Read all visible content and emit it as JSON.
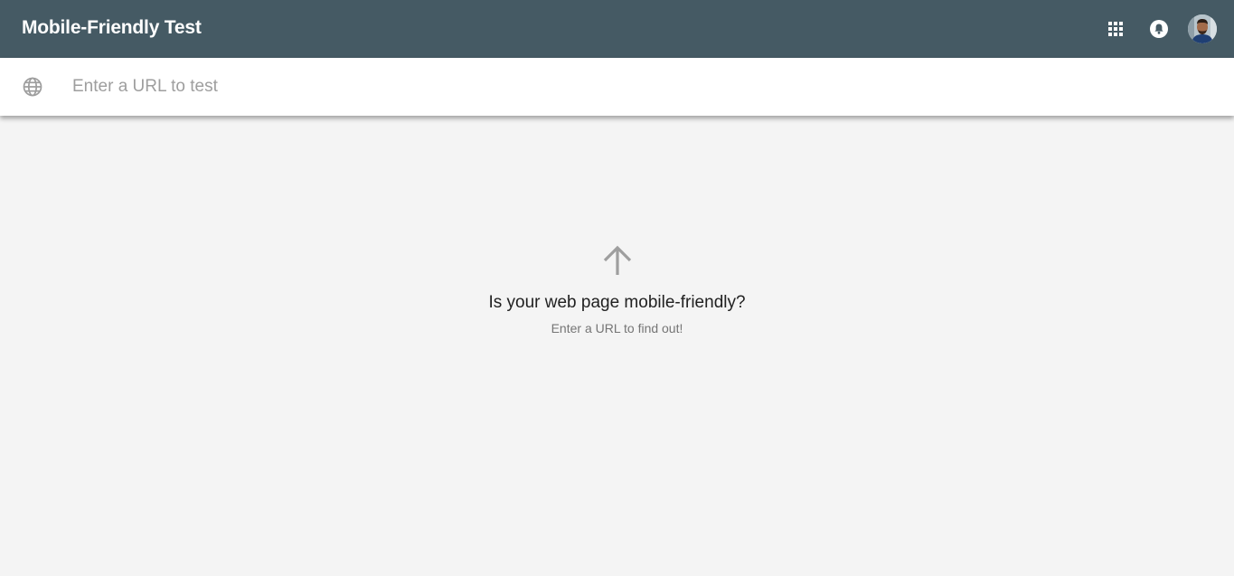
{
  "header": {
    "title": "Mobile-Friendly Test",
    "icons": [
      "apps-icon",
      "notifications-icon",
      "avatar"
    ],
    "background_color": "#455a64"
  },
  "url_bar": {
    "icon": "globe-icon",
    "value": "",
    "placeholder": "Enter a URL to test"
  },
  "empty_state": {
    "icon": "arrow-up-icon",
    "headline": "Is your web page mobile-friendly?",
    "subheadline": "Enter a URL to find out!"
  },
  "colors": {
    "page_background": "#f4f4f4",
    "icon_gray": "#9e9e9e"
  }
}
